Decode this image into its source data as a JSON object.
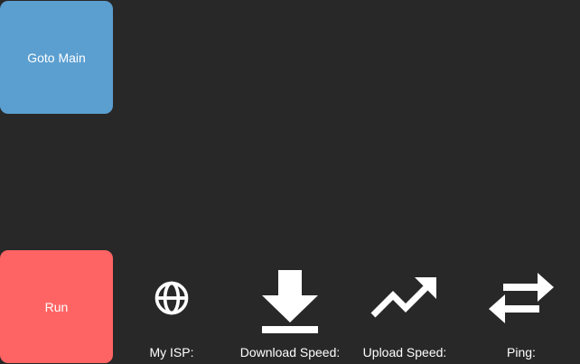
{
  "buttons": {
    "goto_main_label": "Goto Main",
    "run_label": "Run"
  },
  "stats": {
    "isp": {
      "label": "My ISP:",
      "icon": "globe-icon"
    },
    "download": {
      "label": "Download Speed:",
      "icon": "download-icon"
    },
    "upload": {
      "label": "Upload Speed:",
      "icon": "trending-up-icon"
    },
    "ping": {
      "label": "Ping:",
      "icon": "swap-arrows-icon"
    }
  },
  "colors": {
    "background": "#282828",
    "goto_button": "#5b9fd0",
    "run_button": "#ff6464",
    "text": "#ffffff"
  }
}
